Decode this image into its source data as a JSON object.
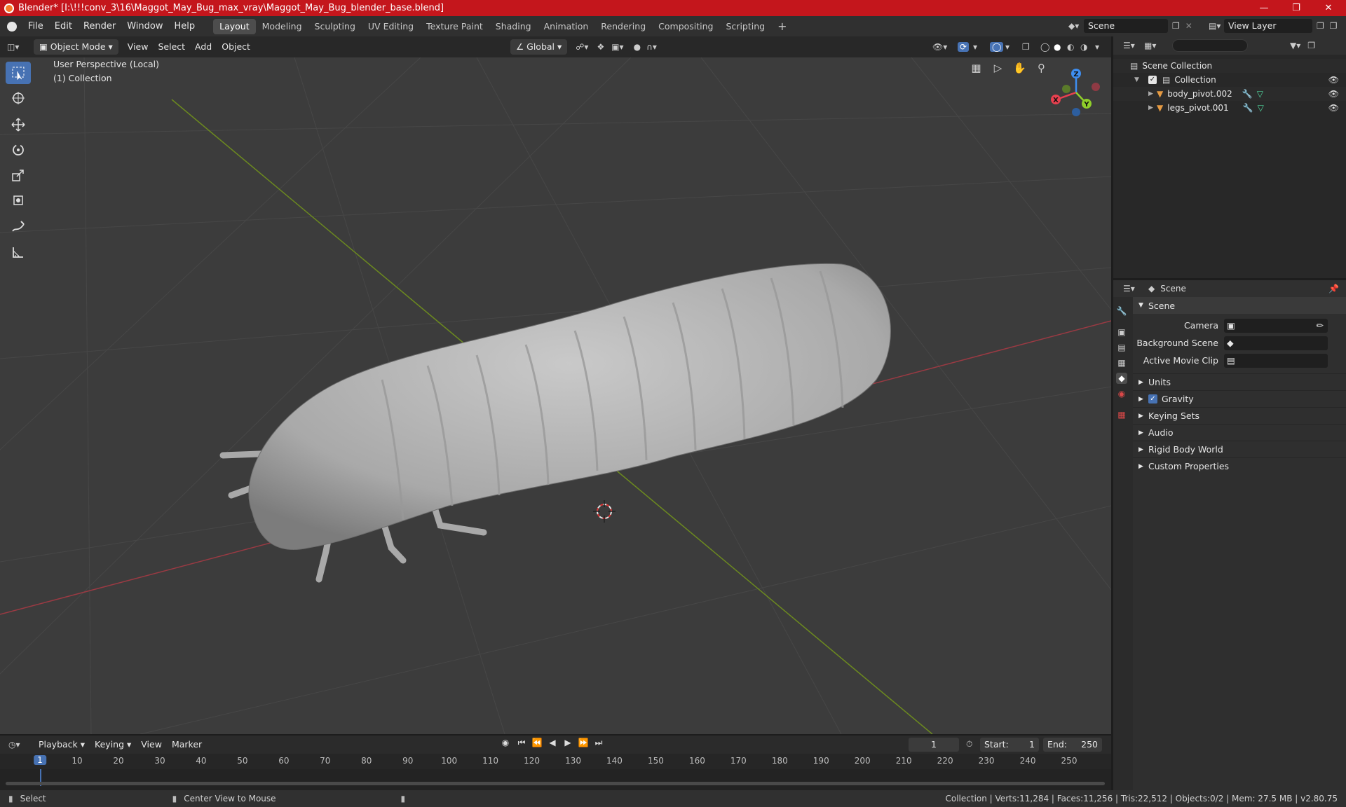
{
  "window": {
    "title": "Blender* [I:\\!!!conv_3\\16\\Maggot_May_Bug_max_vray\\Maggot_May_Bug_blender_base.blend]"
  },
  "menus": [
    "File",
    "Edit",
    "Render",
    "Window",
    "Help"
  ],
  "workspaces": [
    "Layout",
    "Modeling",
    "Sculpting",
    "UV Editing",
    "Texture Paint",
    "Shading",
    "Animation",
    "Rendering",
    "Compositing",
    "Scripting"
  ],
  "topright": {
    "scene": "Scene",
    "view_layer": "View Layer"
  },
  "viewport_header": {
    "mode": "Object Mode",
    "menus": [
      "View",
      "Select",
      "Add",
      "Object"
    ],
    "orientation": "Global"
  },
  "viewport": {
    "perspective": "User Perspective (Local)",
    "collection": "(1) Collection"
  },
  "gizmo": {
    "x": "X",
    "y": "Y",
    "z": "Z"
  },
  "outliner": {
    "search_placeholder": "",
    "root": "Scene Collection",
    "collection": "Collection",
    "objects": [
      "body_pivot.002",
      "legs_pivot.001"
    ]
  },
  "properties": {
    "context": "Scene",
    "panel_title": "Scene",
    "fields": [
      {
        "label": "Camera",
        "value": ""
      },
      {
        "label": "Background Scene",
        "value": ""
      },
      {
        "label": "Active Movie Clip",
        "value": ""
      }
    ],
    "panels": [
      "Units",
      "Gravity",
      "Keying Sets",
      "Audio",
      "Rigid Body World",
      "Custom Properties"
    ],
    "gravity_checked": true
  },
  "timeline": {
    "menus": [
      "Playback",
      "Keying",
      "View",
      "Marker"
    ],
    "current_frame": "1",
    "start_label": "Start:",
    "start": "1",
    "end_label": "End:",
    "end": "250",
    "ticks": [
      "1",
      "10",
      "20",
      "30",
      "40",
      "50",
      "60",
      "70",
      "80",
      "90",
      "100",
      "110",
      "120",
      "130",
      "140",
      "150",
      "160",
      "170",
      "180",
      "190",
      "200",
      "210",
      "220",
      "230",
      "240",
      "250"
    ]
  },
  "statusbar": {
    "left": "Select",
    "middle": "Center View to Mouse",
    "stats": "Collection | Verts:11,284 | Faces:11,256 | Tris:22,512 | Objects:0/2 | Mem: 27.5 MB | v2.80.75"
  },
  "colors": {
    "accent": "#4772b3",
    "titlebar": "#c4161c",
    "x_axis": "#e8404f",
    "y_axis": "#8fcf2a",
    "z_axis": "#3e8ef0"
  }
}
